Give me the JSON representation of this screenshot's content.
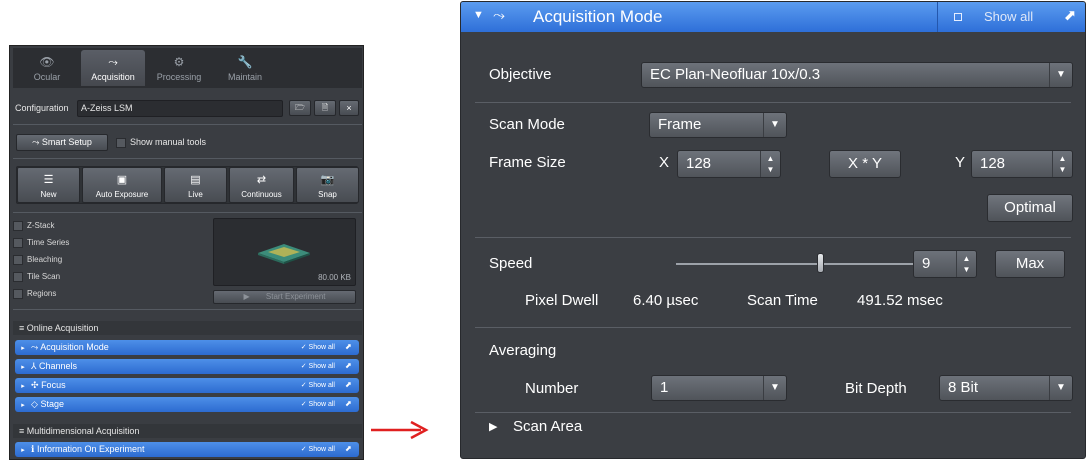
{
  "left_panel": {
    "tabs": [
      {
        "label": "Ocular",
        "icon": "eye-icon",
        "glyph": "👁"
      },
      {
        "label": "Acquisition",
        "icon": "scan-icon",
        "glyph": "⤳"
      },
      {
        "label": "Processing",
        "icon": "gear-icon",
        "glyph": "⚙"
      },
      {
        "label": "Maintain",
        "icon": "wrench-icon",
        "glyph": "🔧"
      }
    ],
    "configuration": {
      "label": "Configuration",
      "value": "A-Zeiss LSM",
      "btn_open": "🗁",
      "btn_save": "🗎",
      "btn_delete": "×"
    },
    "smart_setup_label": "Smart Setup",
    "smart_setup_glyph": "⤳",
    "show_manual_tools_label": "Show manual tools",
    "toolbar": [
      {
        "label": "New",
        "glyph": "☰"
      },
      {
        "label": "Auto Exposure",
        "glyph": "▣"
      },
      {
        "label": "Live",
        "glyph": "▤"
      },
      {
        "label": "Continuous",
        "glyph": "⇄"
      },
      {
        "label": "Snap",
        "glyph": "📷"
      }
    ],
    "options": [
      "Z-Stack",
      "Time Series",
      "Bleaching",
      "Tile Scan",
      "Regions"
    ],
    "file_size": "80.00 KB",
    "start_experiment_label": "Start Experiment",
    "start_experiment_glyph": "▶",
    "online_acquisition": {
      "header": "Online Acquisition",
      "items": [
        {
          "label": "Acquisition Mode",
          "glyph": "⤳"
        },
        {
          "label": "Channels",
          "glyph": "⅄"
        },
        {
          "label": "Focus",
          "glyph": "✣"
        },
        {
          "label": "Stage",
          "glyph": "◇"
        }
      ]
    },
    "multidimensional_acquisition": {
      "header": "Multidimensional Acquisition",
      "items": [
        {
          "label": "Information On Experiment",
          "glyph": "ℹ"
        }
      ]
    },
    "show_all_label": "Show all"
  },
  "right_panel": {
    "title": "Acquisition Mode",
    "show_all_label": "Show all",
    "objective_label": "Objective",
    "objective_value": "EC Plan-Neofluar 10x/0.3",
    "scan_mode_label": "Scan Mode",
    "scan_mode_value": "Frame",
    "frame_size_label": "Frame Size",
    "x_label": "X",
    "x_value": "128",
    "xy_button": "X * Y",
    "y_label": "Y",
    "y_value": "128",
    "optimal_button": "Optimal",
    "speed_label": "Speed",
    "speed_value": "9",
    "speed_fraction": 0.6,
    "max_button": "Max",
    "pixel_dwell_label": "Pixel Dwell",
    "pixel_dwell_value": "6.40 µsec",
    "scan_time_label": "Scan Time",
    "scan_time_value": "491.52 msec",
    "averaging_label": "Averaging",
    "number_label": "Number",
    "number_value": "1",
    "bit_depth_label": "Bit Depth",
    "bit_depth_value": "8 Bit",
    "scan_area_label": "Scan Area"
  },
  "colors": {
    "accent_blue": "#3a7de0",
    "arrow_red": "#e02020",
    "panel_bg": "#3b3e43"
  }
}
